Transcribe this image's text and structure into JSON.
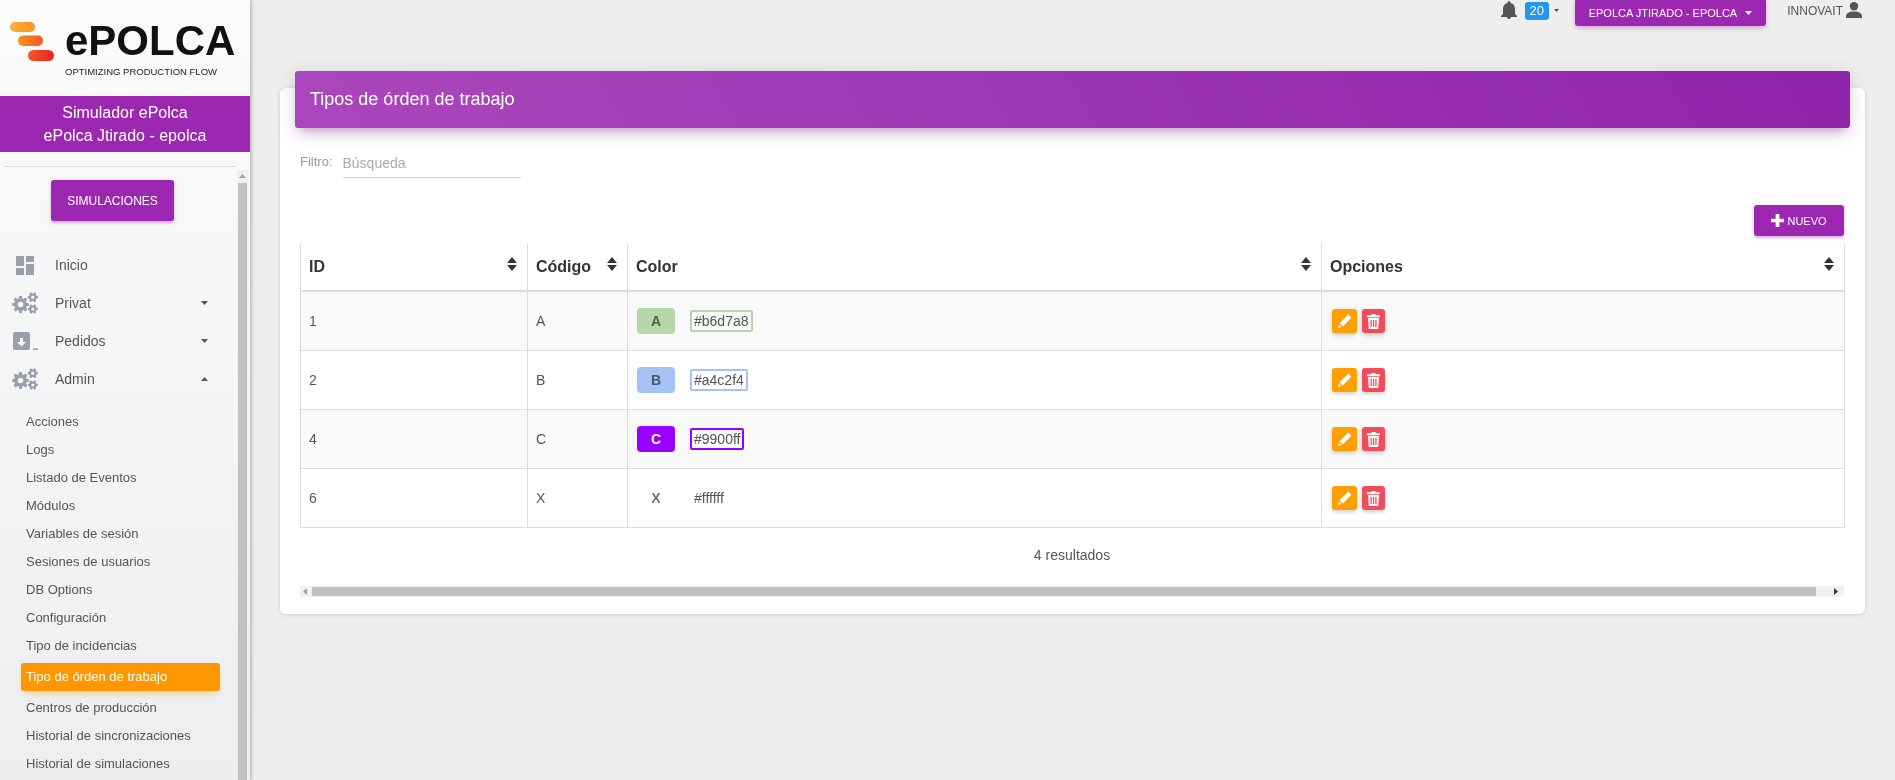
{
  "topbar": {
    "notifications": {
      "count": "20"
    },
    "account_menu": {
      "label": "EPOLCA JTIRADO - EPOLCA"
    },
    "user": {
      "label": "INNOVAIT"
    }
  },
  "sidebar": {
    "logo": {
      "wordmark": "ePOLCA",
      "tagline": "OPTIMIZING PRODUCTION FLOW"
    },
    "banner": {
      "lines": [
        "Simulador ePolca",
        "ePolca Jtirado - epolca"
      ]
    },
    "primary_button": "SIMULACIONES",
    "menu": [
      {
        "label": "Inicio",
        "kind": "link"
      },
      {
        "label": "Privat",
        "kind": "group",
        "expanded": false
      },
      {
        "label": "Pedidos",
        "kind": "group",
        "expanded": false
      },
      {
        "label": "Admin",
        "kind": "group",
        "expanded": true,
        "children": [
          {
            "label": "Acciones",
            "selected": false
          },
          {
            "label": "Logs",
            "selected": false
          },
          {
            "label": "Listado de Eventos",
            "selected": false
          },
          {
            "label": "Módulos",
            "selected": false
          },
          {
            "label": "Variables de sesión",
            "selected": false
          },
          {
            "label": "Sesiones de usuarios",
            "selected": false
          },
          {
            "label": "DB Options",
            "selected": false
          },
          {
            "label": "Configuración",
            "selected": false
          },
          {
            "label": "Tipo de incidencias",
            "selected": false
          },
          {
            "label": "Tipo de órden de trabajo",
            "selected": true
          },
          {
            "label": "Centros de producción",
            "selected": false
          },
          {
            "label": "Historial de sincronizaciones",
            "selected": false
          },
          {
            "label": "Historial de simulaciones",
            "selected": false
          }
        ]
      }
    ]
  },
  "page": {
    "title": "Tipos de órden de trabajo",
    "filter": {
      "label": "Filtro:",
      "placeholder": "Búsqueda"
    },
    "new_button": "NUEVO",
    "table": {
      "columns": [
        {
          "label": "ID",
          "sortable": true
        },
        {
          "label": "Código",
          "sortable": true
        },
        {
          "label": "Color",
          "sortable": true
        },
        {
          "label": "Opciones",
          "sortable": true
        }
      ],
      "rows": [
        {
          "id": "1",
          "code": "A",
          "badge": "A",
          "color": "#b6d7a8",
          "hex": "#b6d7a8"
        },
        {
          "id": "2",
          "code": "B",
          "badge": "B",
          "color": "#a4c2f4",
          "hex": "#a4c2f4"
        },
        {
          "id": "4",
          "code": "C",
          "badge": "C",
          "color": "#9900ff",
          "hex": "#9900ff"
        },
        {
          "id": "6",
          "code": "X",
          "badge": "X",
          "color": "#ffffff",
          "hex": "#ffffff"
        }
      ]
    },
    "result_count": "4 resultados"
  }
}
